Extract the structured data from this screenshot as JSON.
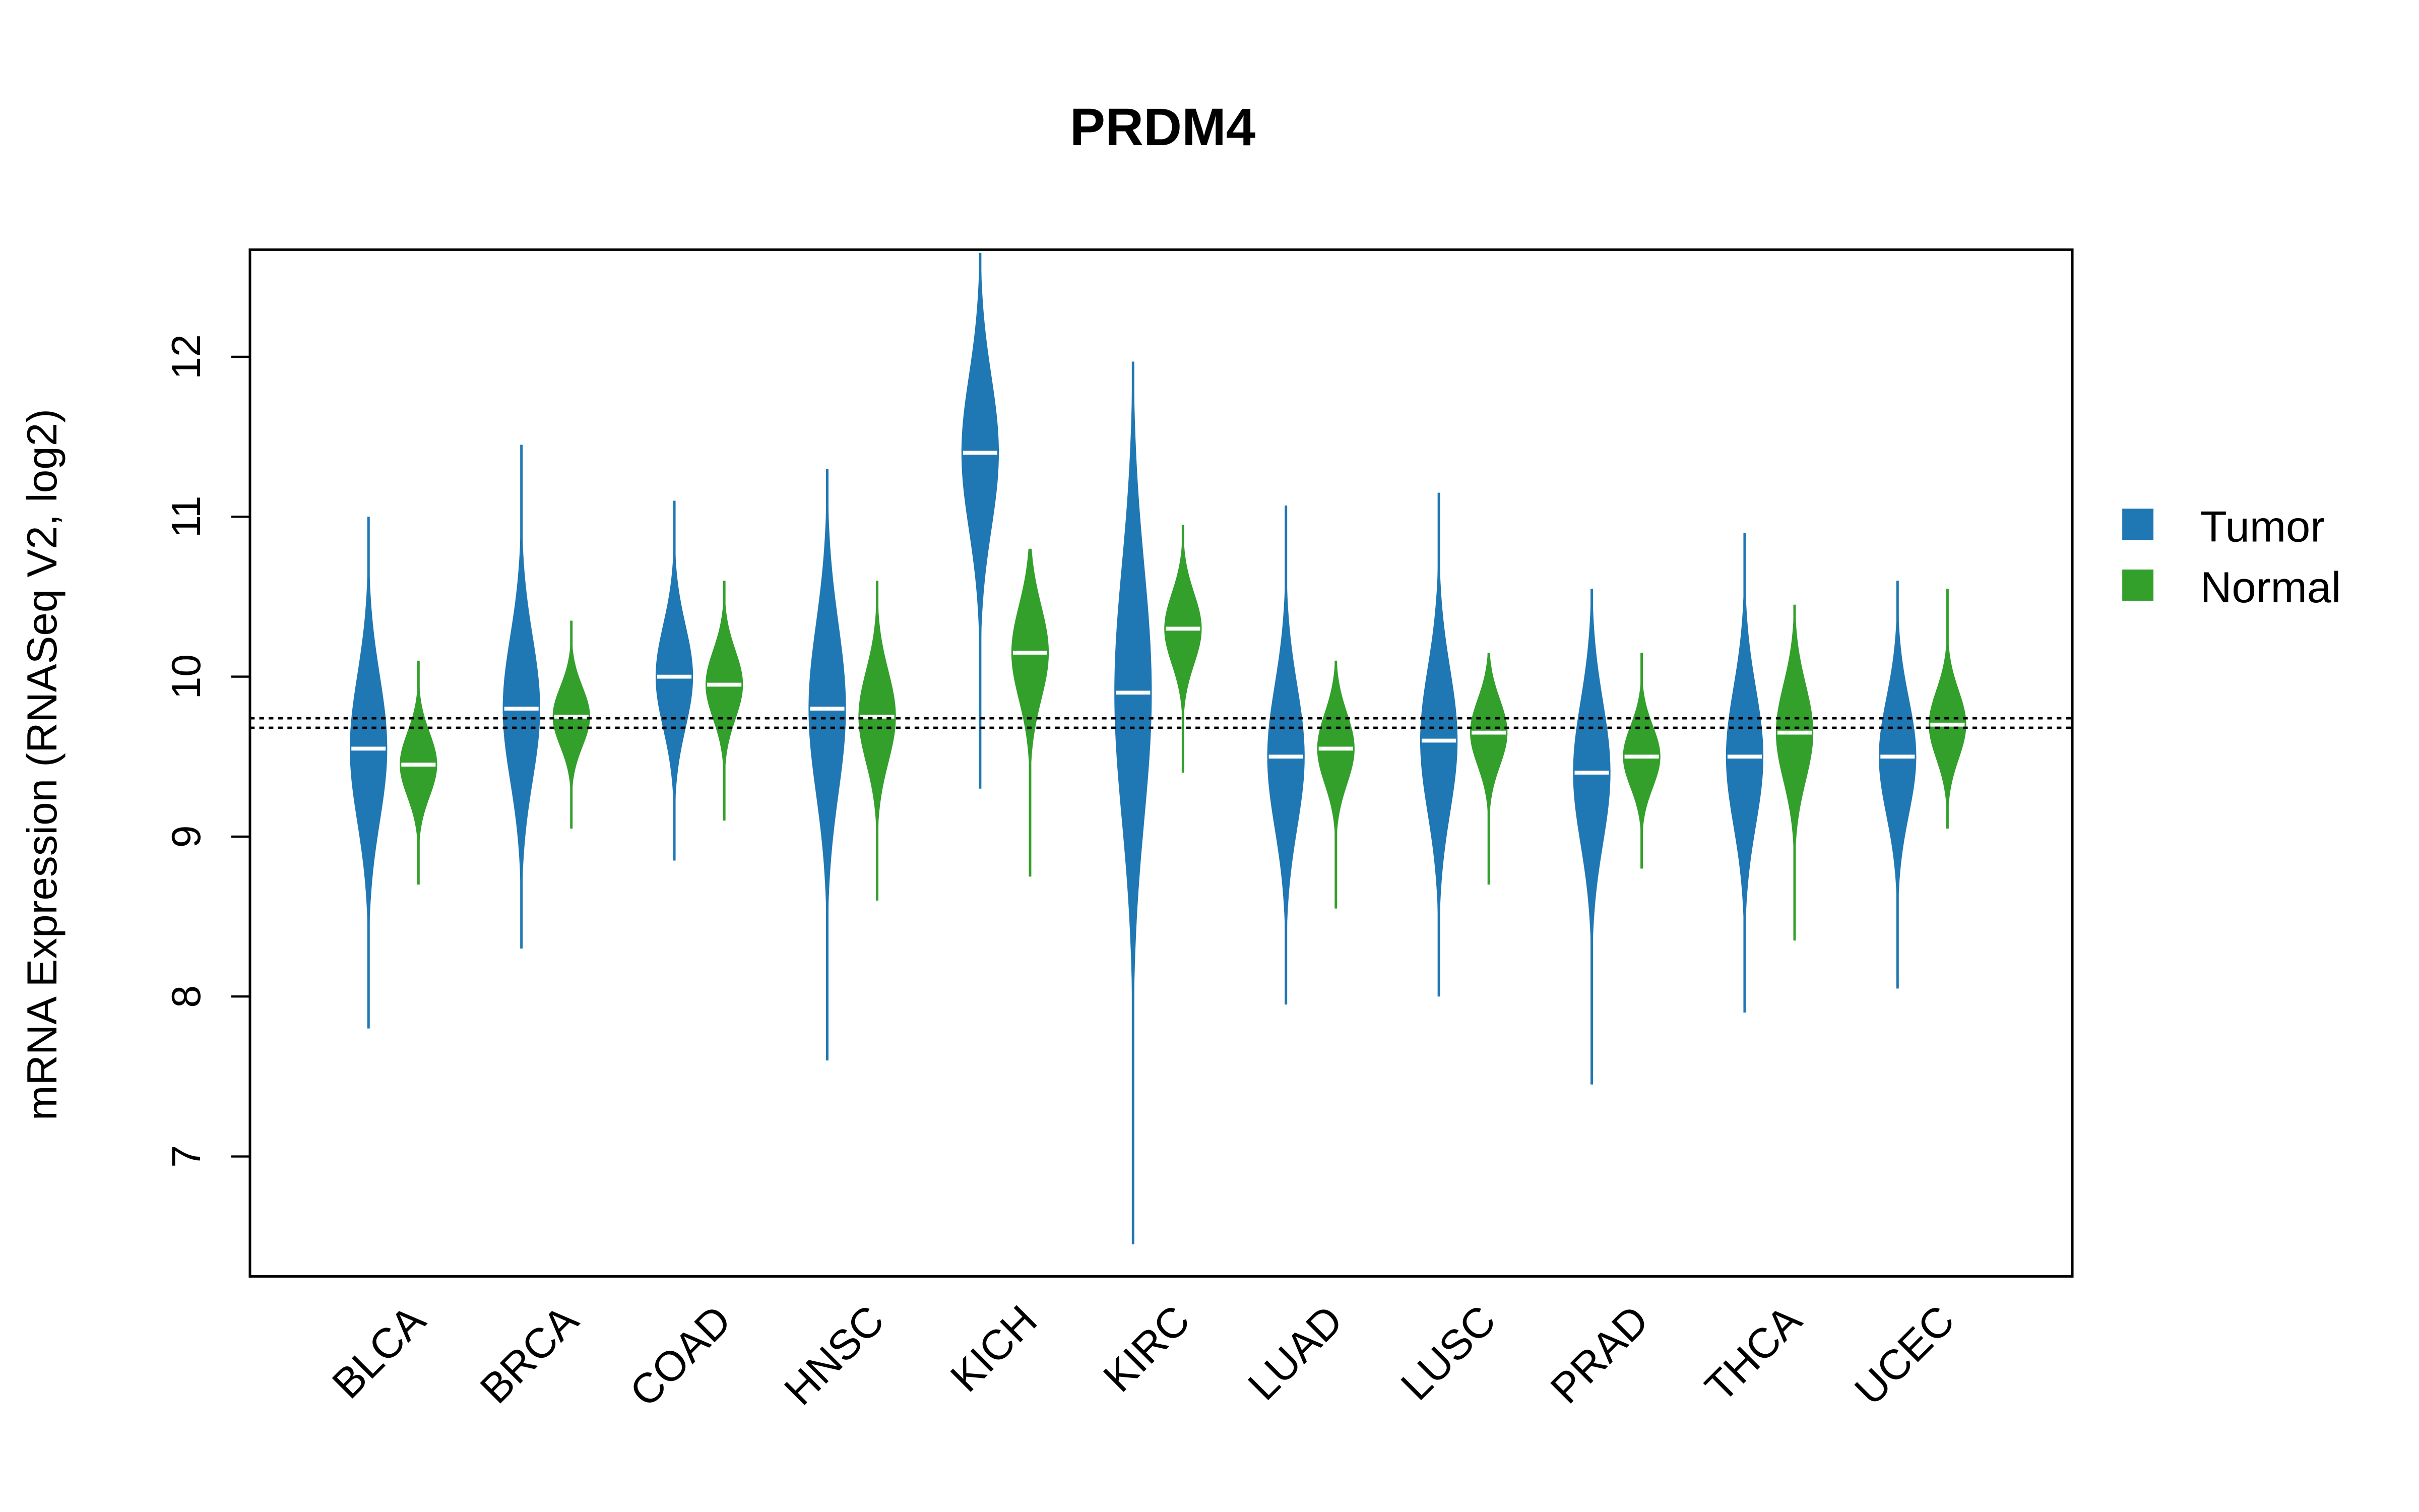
{
  "chart_data": {
    "type": "violin",
    "title": "PRDM4",
    "xlabel": "",
    "ylabel": "mRNA Expression (RNASeq V2, log2)",
    "ylim": [
      6.25,
      12.67
    ],
    "yticks": [
      7,
      8,
      9,
      10,
      11,
      12
    ],
    "categories": [
      "BLCA",
      "BRCA",
      "COAD",
      "HNSC",
      "KICH",
      "KIRC",
      "LUAD",
      "LUSC",
      "PRAD",
      "THCA",
      "UCEC"
    ],
    "reference_lines": [
      9.74,
      9.68
    ],
    "legend": {
      "placement": "right",
      "entries": [
        "Tumor",
        "Normal"
      ]
    },
    "colors": {
      "Tumor": "#1f78b4",
      "Normal": "#33a02c"
    },
    "series": [
      {
        "name": "Tumor",
        "min": [
          7.8,
          8.3,
          8.85,
          7.6,
          9.3,
          6.45,
          7.95,
          8.0,
          7.45,
          7.9,
          8.05
        ],
        "max": [
          11.0,
          11.45,
          11.1,
          11.3,
          12.65,
          11.97,
          11.07,
          11.15,
          10.55,
          10.9,
          10.6
        ],
        "median": [
          9.55,
          9.8,
          10.0,
          9.8,
          11.4,
          9.9,
          9.5,
          9.6,
          9.4,
          9.5,
          9.5
        ]
      },
      {
        "name": "Normal",
        "min": [
          8.7,
          9.05,
          9.1,
          8.6,
          8.75,
          9.4,
          8.55,
          8.7,
          8.8,
          8.35,
          9.05
        ],
        "max": [
          10.1,
          10.35,
          10.6,
          10.6,
          10.8,
          10.95,
          10.1,
          10.15,
          10.15,
          10.45,
          10.55
        ],
        "median": [
          9.45,
          9.75,
          9.95,
          9.75,
          10.15,
          10.3,
          9.55,
          9.65,
          9.5,
          9.65,
          9.7
        ]
      }
    ]
  }
}
